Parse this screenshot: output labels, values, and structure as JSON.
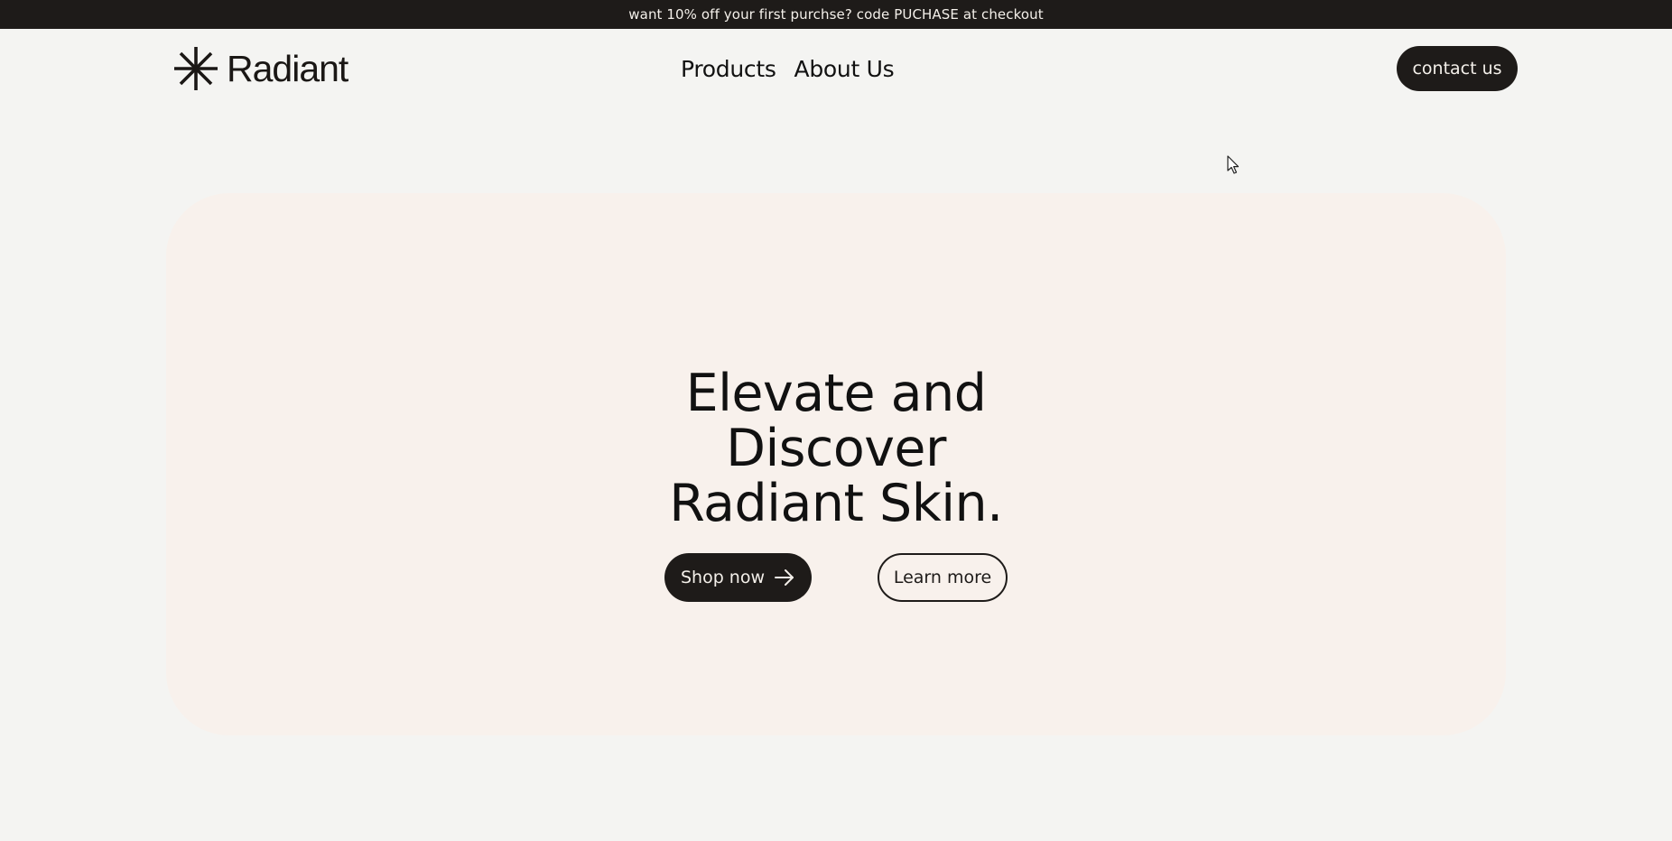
{
  "promo": {
    "text": "want 10% off your first purchse? code PUCHASE at checkout"
  },
  "header": {
    "logo_text": "Radiant",
    "logo_icon": "asterisk-burst-icon",
    "nav": [
      {
        "label": "Products"
      },
      {
        "label": "About Us"
      }
    ],
    "contact_label": "contact us"
  },
  "hero": {
    "title_lines": [
      "Elevate and",
      "Discover",
      "Radiant Skin."
    ],
    "primary_button": {
      "label": "Shop now",
      "icon": "arrow-right-icon"
    },
    "secondary_button": {
      "label": "Learn more"
    }
  },
  "colors": {
    "page_background": "#f4f4f2",
    "hero_background": "#f8f1ec",
    "dark": "#1e1b19",
    "light_text": "#f4f0ea"
  }
}
